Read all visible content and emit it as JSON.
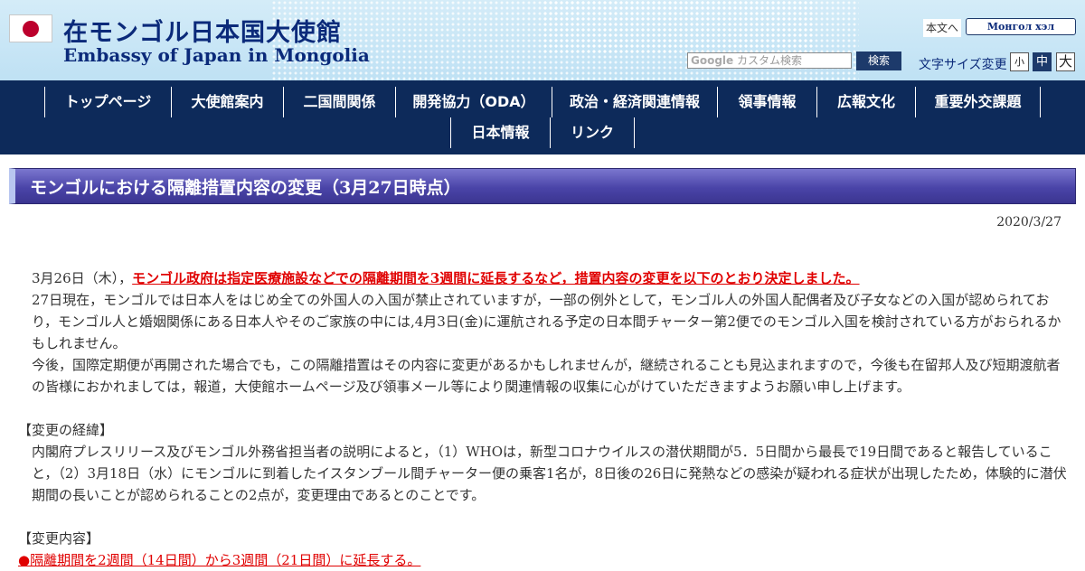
{
  "header": {
    "title_ja": "在モンゴル日本国大使館",
    "title_en": "Embassy of Japan in Mongolia",
    "honbun_link": "本文へ",
    "language_button": "Монгол хэл",
    "search_brand": "Google",
    "search_placeholder": "カスタム検索",
    "search_button": "検索",
    "font_size_label": "文字サイズ変更",
    "font_size_small": "小",
    "font_size_medium": "中",
    "font_size_large": "大"
  },
  "nav": {
    "row1": [
      "トップページ",
      "大使館案内",
      "二国間関係",
      "開発協力（ODA）",
      "政治・経済関連情報",
      "領事情報",
      "広報文化",
      "重要外交課題"
    ],
    "row2": [
      "日本情報",
      "リンク"
    ]
  },
  "article": {
    "heading": "モンゴルにおける隔離措置内容の変更（3月27日時点）",
    "date": "2020/3/27",
    "p1_lead": "3月26日（木），",
    "p1_link": "モンゴル政府は指定医療施設などでの隔離期間を3週間に延長するなど，措置内容の変更を以下のとおり決定しました。",
    "p2": "27日現在，モンゴルでは日本人をはじめ全ての外国人の入国が禁止されていますが，一部の例外として，モンゴル人の外国人配偶者及び子女などの入国が認められており，モンゴル人と婚姻関係にある日本人やそのご家族の中には,4月3日(金)に運航される予定の日本間チャーター第2便でのモンゴル入国を検討されている方がおられるかもしれません。",
    "p3": "今後，国際定期便が再開された場合でも，この隔離措置はその内容に変更があるかもしれませんが，継続されることも見込まれますので，今後も在留邦人及び短期渡航者の皆様におかれましては，報道，大使館ホームページ及び領事メール等により関連情報の収集に心がけていただきますようお願い申し上げます。",
    "section1_title": "【変更の経緯】",
    "section1_body": "内閣府プレスリリース及びモンゴル外務省担当者の説明によると，（1）WHOは，新型コロナウイルスの潜伏期間が5．5日間から最長で19日間であると報告していること，（2）3月18日（水）にモンゴルに到着したイスタンブール間チャーター便の乗客1名が，8日後の26日に発熱などの感染が疑われる症状が出現したため，体験的に潜伏期間の長いことが認められることの2点が，変更理由であるとのことです。",
    "section2_title": "【変更内容】",
    "section2_item1": "●隔離期間を2週間（14日間）から3週間（21日間）に延長する。"
  },
  "colors": {
    "header_bg": "#c8e6f6",
    "nav_bg": "#0d2a5a",
    "heading_bg": "#4a44a8",
    "link_red": "#e00000",
    "title_blue": "#0b2a7a"
  }
}
